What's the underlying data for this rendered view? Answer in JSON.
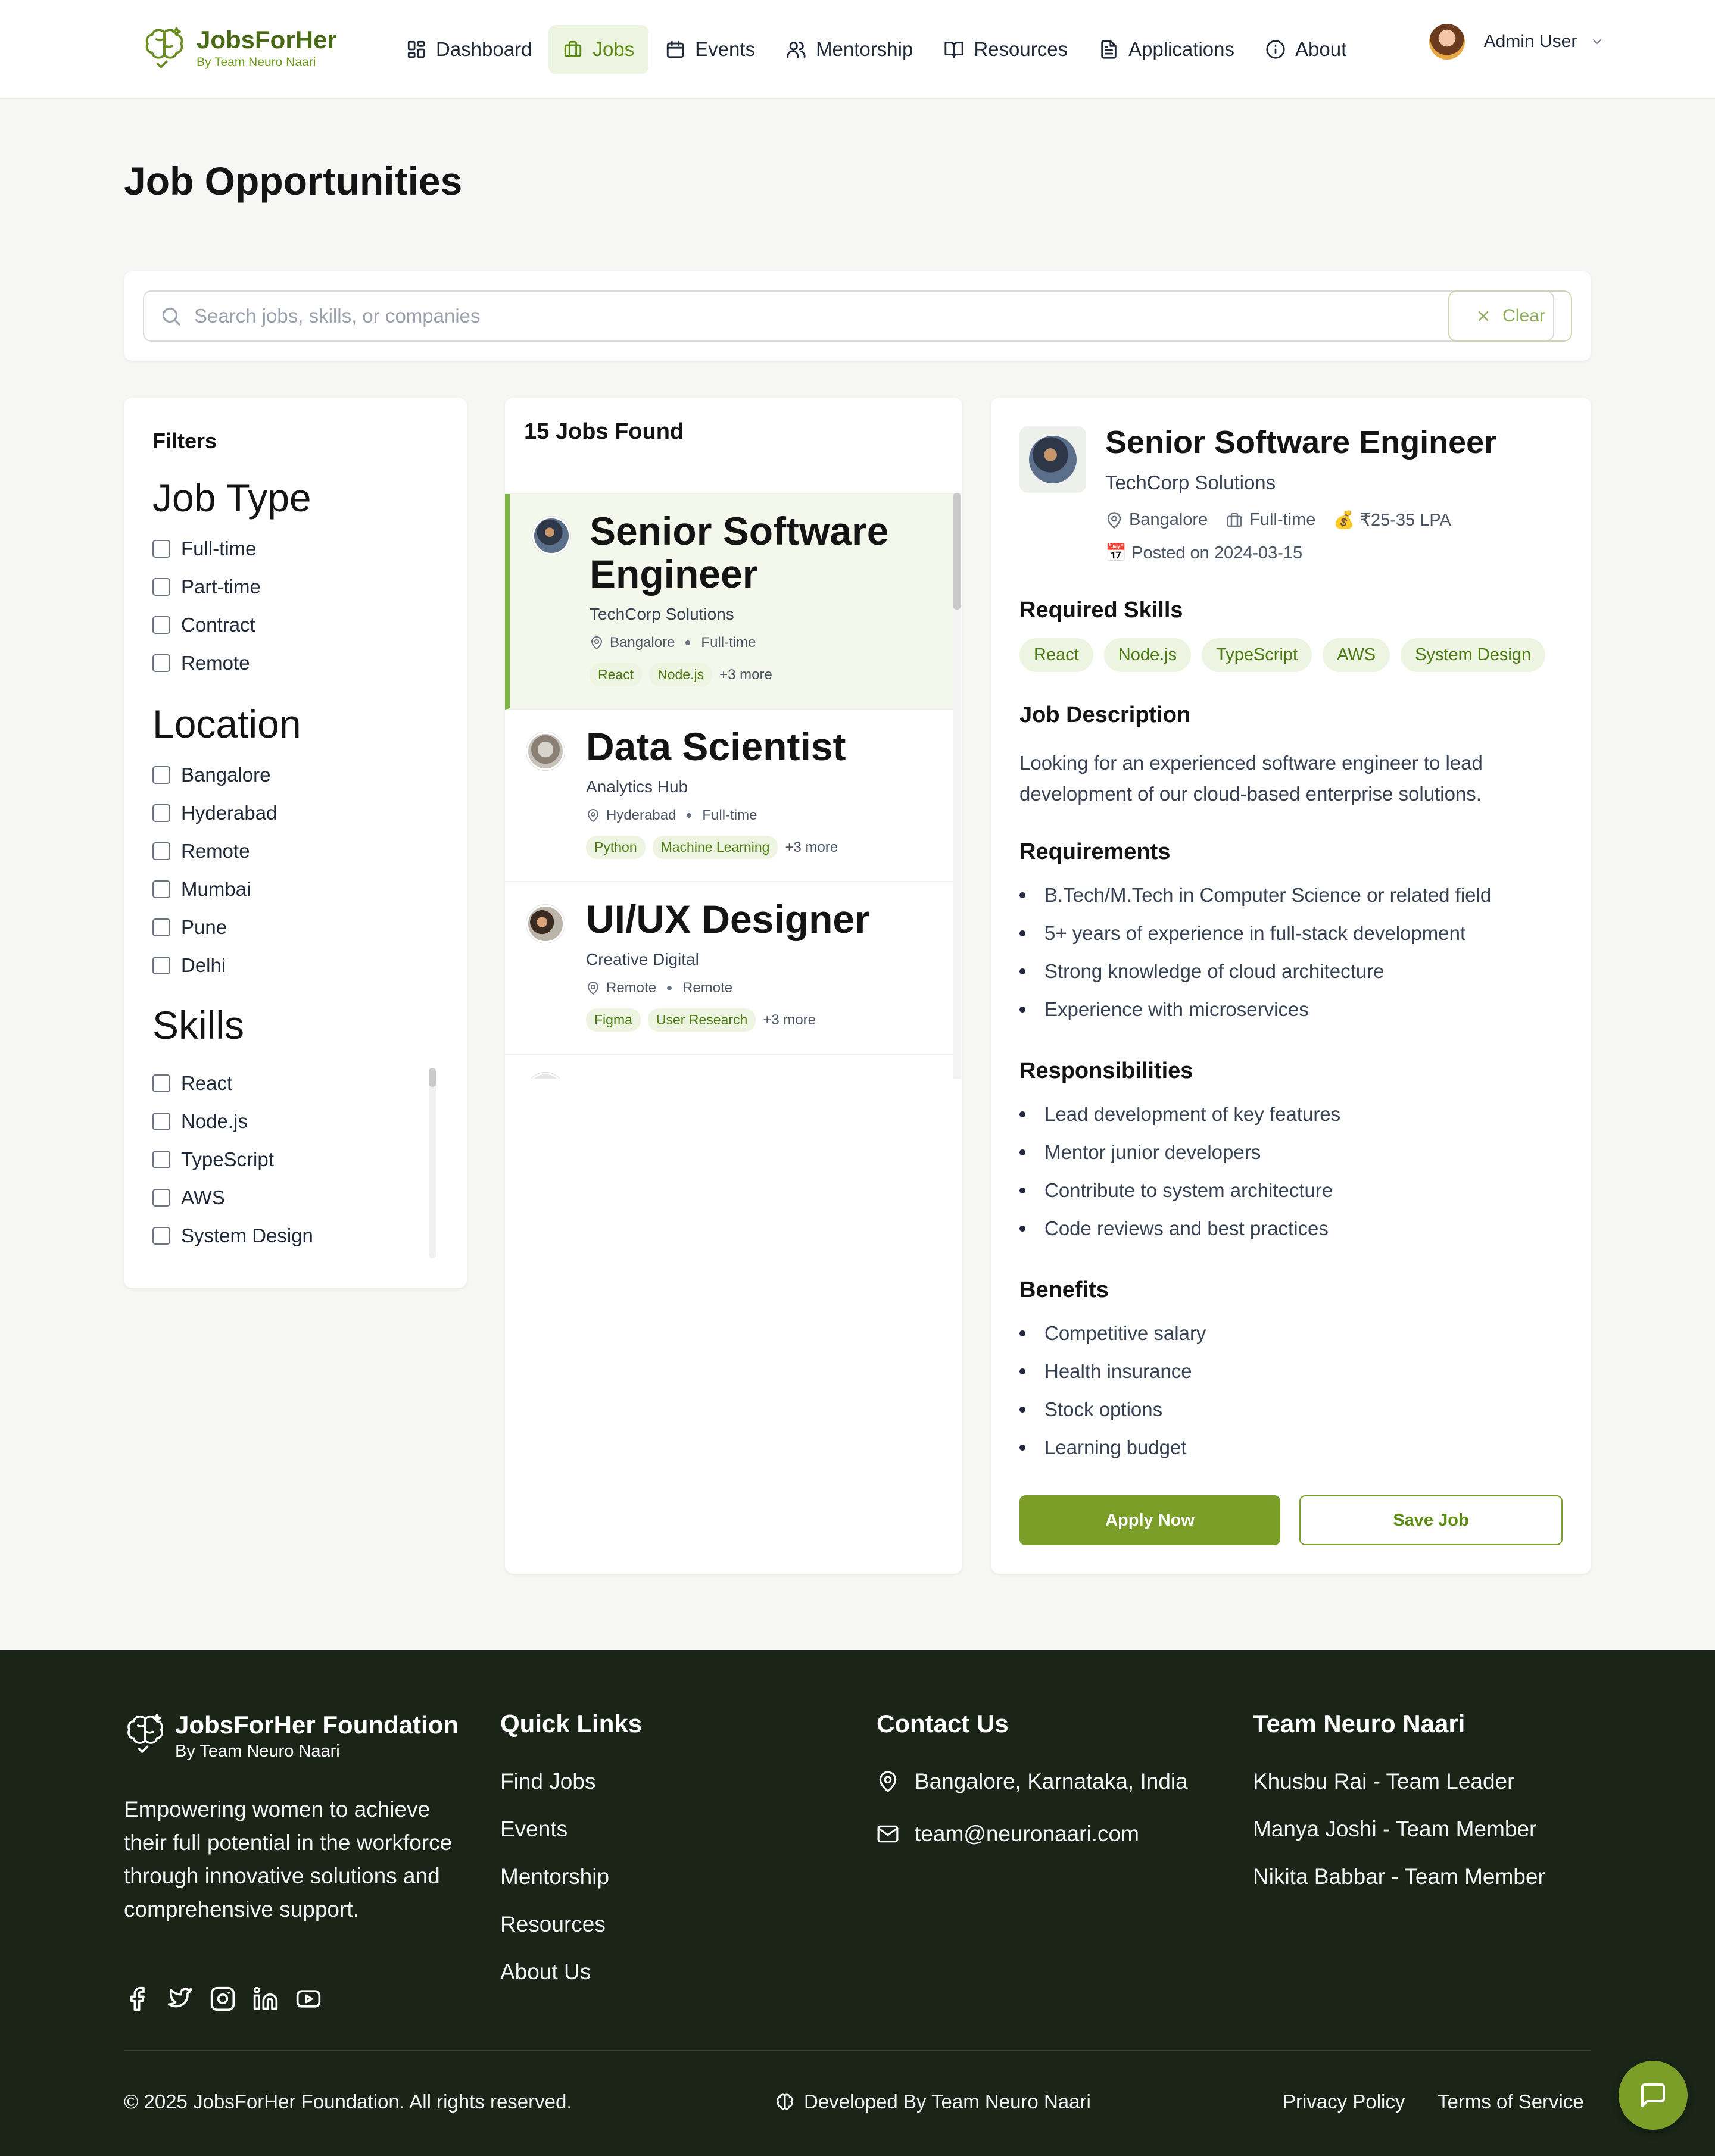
{
  "brand": {
    "name": "JobsForHer",
    "subtitle": "By Team Neuro Naari"
  },
  "nav": {
    "items": [
      {
        "label": "Dashboard",
        "icon": "dashboard-icon"
      },
      {
        "label": "Jobs",
        "icon": "briefcase-icon",
        "active": true
      },
      {
        "label": "Events",
        "icon": "calendar-icon"
      },
      {
        "label": "Mentorship",
        "icon": "users-icon"
      },
      {
        "label": "Resources",
        "icon": "book-icon"
      },
      {
        "label": "Applications",
        "icon": "file-icon"
      },
      {
        "label": "About",
        "icon": "info-icon"
      }
    ]
  },
  "user": {
    "name": "Admin User"
  },
  "page": {
    "title": "Job Opportunities"
  },
  "search": {
    "placeholder": "Search jobs, skills, or companies",
    "value": "",
    "clear_label": "Clear"
  },
  "filters": {
    "title": "Filters",
    "job_type": {
      "title": "Job Type",
      "options": [
        "Full-time",
        "Part-time",
        "Contract",
        "Remote"
      ]
    },
    "location": {
      "title": "Location",
      "options": [
        "Bangalore",
        "Hyderabad",
        "Remote",
        "Mumbai",
        "Pune",
        "Delhi"
      ]
    },
    "skills": {
      "title": "Skills",
      "options": [
        "React",
        "Node.js",
        "TypeScript",
        "AWS",
        "System Design"
      ]
    }
  },
  "job_list": {
    "count_label": "15 Jobs Found",
    "jobs": [
      {
        "title": "Senior Software Engineer",
        "company": "TechCorp Solutions",
        "location": "Bangalore",
        "type": "Full-time",
        "tags": [
          "React",
          "Node.js"
        ],
        "more": "+3 more"
      },
      {
        "title": "Data Scientist",
        "company": "Analytics Hub",
        "location": "Hyderabad",
        "type": "Full-time",
        "tags": [
          "Python",
          "Machine Learning"
        ],
        "more": "+3 more"
      },
      {
        "title": "UI/UX Designer",
        "company": "Creative Digital",
        "location": "Remote",
        "type": "Remote",
        "tags": [
          "Figma",
          "User Research"
        ],
        "more": "+3 more"
      }
    ]
  },
  "detail": {
    "title": "Senior Software Engineer",
    "company": "TechCorp Solutions",
    "location": "Bangalore",
    "type": "Full-time",
    "salary": "💰 ₹25-35 LPA",
    "posted": "📅 Posted on 2024-03-15",
    "skills_heading": "Required Skills",
    "skills": [
      "React",
      "Node.js",
      "TypeScript",
      "AWS",
      "System Design"
    ],
    "description_heading": "Job Description",
    "description": "Looking for an experienced software engineer to lead development of our cloud-based enterprise solutions.",
    "requirements_heading": "Requirements",
    "requirements": [
      "B.Tech/M.Tech in Computer Science or related field",
      "5+ years of experience in full-stack development",
      "Strong knowledge of cloud architecture",
      "Experience with microservices"
    ],
    "responsibilities_heading": "Responsibilities",
    "responsibilities": [
      "Lead development of key features",
      "Mentor junior developers",
      "Contribute to system architecture",
      "Code reviews and best practices"
    ],
    "benefits_heading": "Benefits",
    "benefits": [
      "Competitive salary",
      "Health insurance",
      "Stock options",
      "Learning budget"
    ],
    "apply_label": "Apply Now",
    "save_label": "Save Job"
  },
  "footer": {
    "brand_name": "JobsForHer Foundation",
    "brand_sub": "By Team Neuro Naari",
    "about": "Empowering women to achieve their full potential in the workforce through innovative solutions and comprehensive support.",
    "quick_links_heading": "Quick Links",
    "quick_links": [
      "Find Jobs",
      "Events",
      "Mentorship",
      "Resources",
      "About Us"
    ],
    "contact_heading": "Contact Us",
    "contact_address": "Bangalore, Karnataka, India",
    "contact_email": "team@neuronaari.com",
    "team_heading": "Team Neuro Naari",
    "team": [
      "Khusbu Rai - Team Leader",
      "Manya Joshi - Team Member",
      "Nikita Babbar - Team Member"
    ],
    "copyright": "© 2025 JobsForHer Foundation. All rights reserved.",
    "developed_by": "Developed By Team Neuro Naari",
    "privacy": "Privacy Policy",
    "terms": "Terms of Service"
  },
  "colors": {
    "accent": "#7a9e28",
    "brand_dark": "#4a6a17",
    "footer_bg": "#1a2417",
    "tag_bg": "#eef4e2"
  }
}
